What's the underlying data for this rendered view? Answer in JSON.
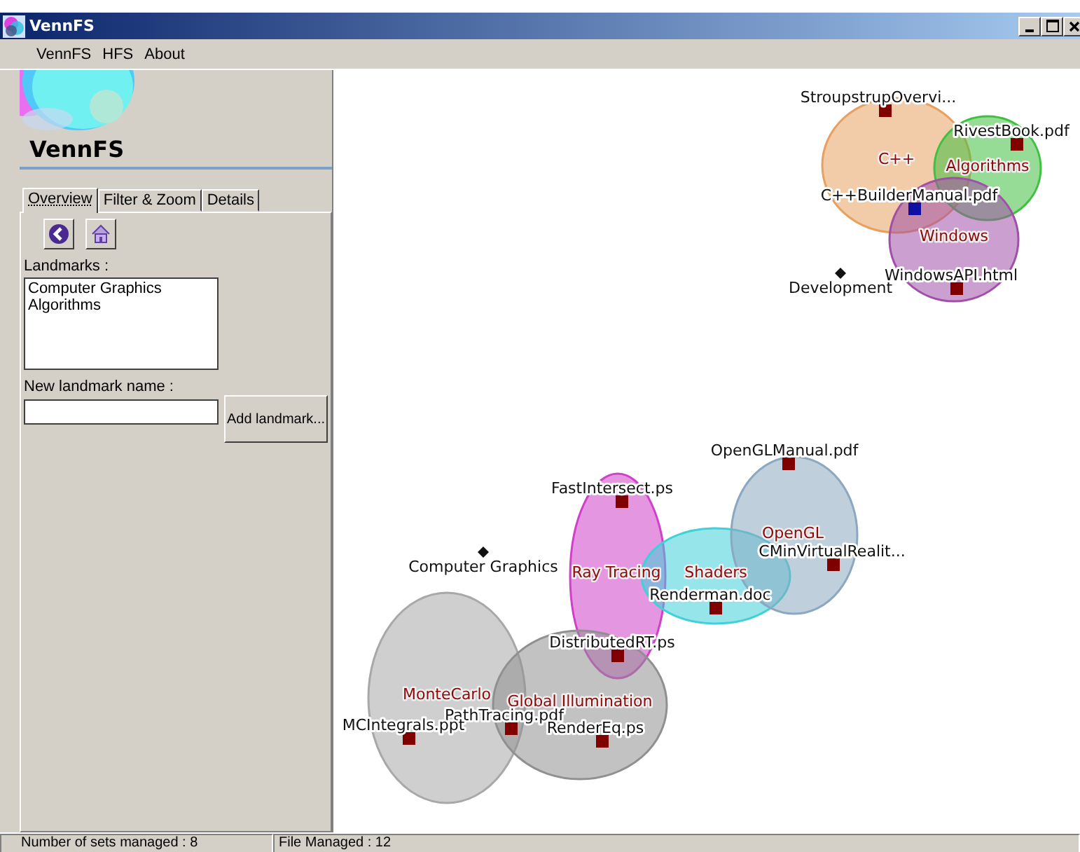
{
  "window": {
    "title": "VennFS"
  },
  "menu": [
    "VennFS",
    "HFS",
    "About"
  ],
  "side": {
    "heading": "VennFS",
    "tabs": [
      {
        "label": "Overview",
        "selected": true
      },
      {
        "label": "Filter & Zoom",
        "selected": false
      },
      {
        "label": "Details",
        "selected": false
      }
    ],
    "landmarks_label": "Landmarks :",
    "landmarks": [
      "Computer Graphics",
      "Algorithms"
    ],
    "new_landmark": {
      "label": "New landmark name :"
    },
    "add_button": "Add landmark..."
  },
  "canvas": {
    "sets": [
      {
        "name": "C++",
        "color": "#e8a060"
      },
      {
        "name": "Algorithms",
        "color": "#40c040"
      },
      {
        "name": "Windows",
        "color": "#a050a8"
      },
      {
        "name": "MonteCarlo",
        "color": "#a8a8a8"
      },
      {
        "name": "Ray Tracing",
        "color": "#d040c8"
      },
      {
        "name": "Global Illumination",
        "color": "#909090"
      },
      {
        "name": "Shaders",
        "color": "#40d0d8"
      },
      {
        "name": "OpenGL",
        "color": "#8ca8c0"
      }
    ],
    "landmarks": [
      {
        "name": "Development"
      },
      {
        "name": "Computer Graphics"
      }
    ],
    "files": [
      {
        "name": "StroupstrupOvervi...",
        "selected": false
      },
      {
        "name": "RivestBook.pdf",
        "selected": false
      },
      {
        "name": "C++BuilderManual.pdf",
        "selected": true
      },
      {
        "name": "WindowsAPI.html",
        "selected": false
      },
      {
        "name": "OpenGLManual.pdf",
        "selected": false
      },
      {
        "name": "FastIntersect.ps",
        "selected": false
      },
      {
        "name": "CMinVirtualRealit...",
        "selected": false
      },
      {
        "name": "Renderman.doc",
        "selected": false
      },
      {
        "name": "DistributedRT.ps",
        "selected": false
      },
      {
        "name": "PathTracing.pdf",
        "selected": false
      },
      {
        "name": "MCIntegrals.ppt",
        "selected": false
      },
      {
        "name": "RenderEq.ps",
        "selected": false
      }
    ]
  },
  "status_bar": [
    "Number of sets managed : 8",
    "File Managed : 12"
  ]
}
